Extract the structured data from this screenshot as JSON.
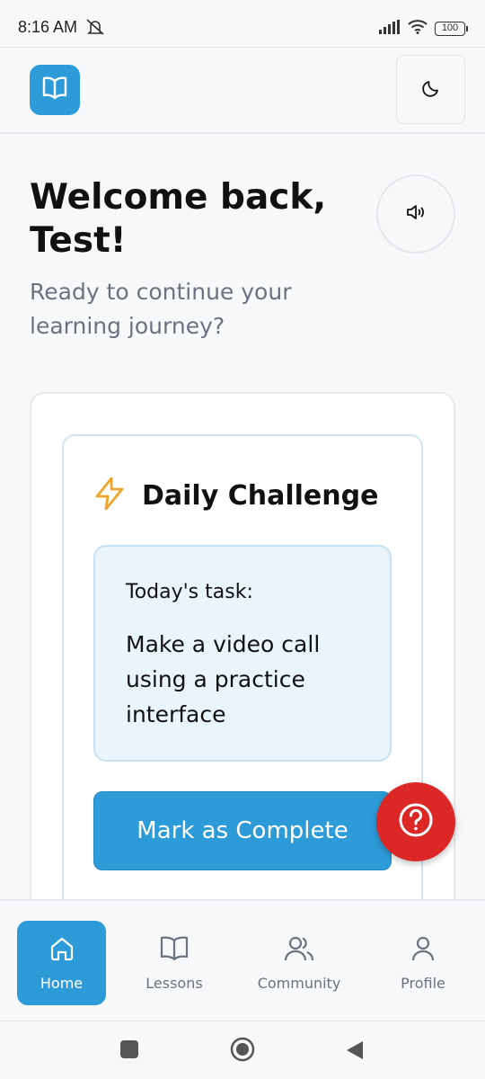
{
  "status": {
    "time": "8:16 AM",
    "battery": "100"
  },
  "header": {
    "logo_icon": "book-open-icon",
    "theme_icon": "moon-icon"
  },
  "welcome": {
    "title": "Welcome back, Test!",
    "subtitle": "Ready to continue your learning journey?",
    "audio_icon": "speaker-icon"
  },
  "challenge": {
    "icon": "lightning-icon",
    "title": "Daily Challenge",
    "task_label": "Today's task:",
    "task_text": "Make a video call using a practice interface",
    "button_label": "Mark as Complete"
  },
  "help": {
    "icon": "help-circle-icon"
  },
  "nav": {
    "items": [
      {
        "label": "Home",
        "icon": "home-icon",
        "active": true
      },
      {
        "label": "Lessons",
        "icon": "book-icon",
        "active": false
      },
      {
        "label": "Community",
        "icon": "users-icon",
        "active": false
      },
      {
        "label": "Profile",
        "icon": "user-icon",
        "active": false
      }
    ]
  },
  "colors": {
    "primary": "#2d9bd8",
    "help": "#dc2727",
    "accent_bolt": "#f0a52a"
  }
}
